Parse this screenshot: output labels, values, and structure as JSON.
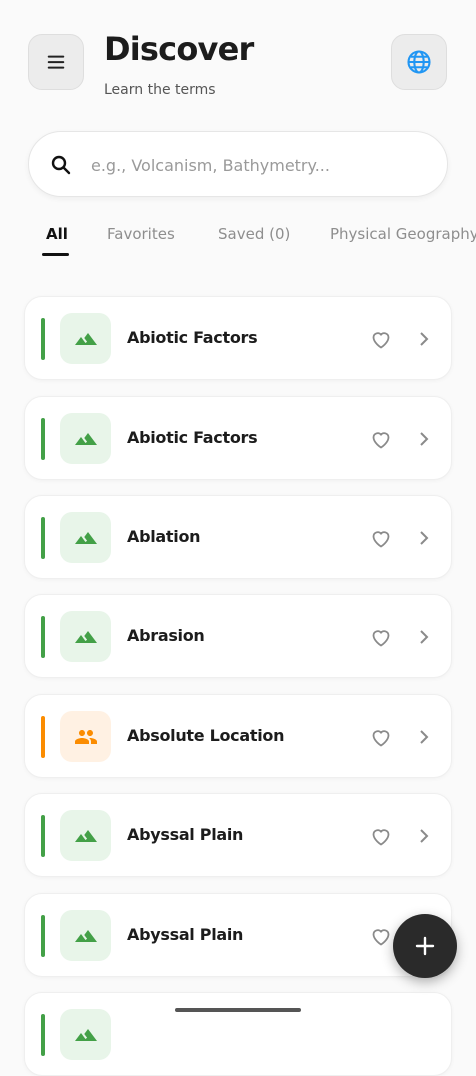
{
  "header": {
    "title": "Discover",
    "subtitle": "Learn the terms",
    "menu_icon": "hamburger-menu-icon",
    "globe_icon": "globe-icon"
  },
  "search": {
    "placeholder": "e.g., Volcanism, Bathymetry...",
    "value": "",
    "icon": "search-icon"
  },
  "tabs": [
    {
      "label": "All",
      "active": true
    },
    {
      "label": "Favorites",
      "active": false
    },
    {
      "label": "Saved (0)",
      "active": false
    },
    {
      "label": "Physical Geography",
      "active": false
    }
  ],
  "terms": [
    {
      "label": "Abiotic Factors",
      "category": "physical",
      "icon": "mountain-icon"
    },
    {
      "label": "Abiotic Factors",
      "category": "physical",
      "icon": "mountain-icon"
    },
    {
      "label": "Ablation",
      "category": "physical",
      "icon": "mountain-icon"
    },
    {
      "label": "Abrasion",
      "category": "physical",
      "icon": "mountain-icon"
    },
    {
      "label": "Absolute Location",
      "category": "human",
      "icon": "people-icon"
    },
    {
      "label": "Abyssal Plain",
      "category": "physical",
      "icon": "mountain-icon"
    },
    {
      "label": "Abyssal Plain",
      "category": "physical",
      "icon": "mountain-icon"
    },
    {
      "label": "",
      "category": "physical",
      "icon": "mountain-icon"
    }
  ],
  "colors": {
    "physical_accent": "#43a047",
    "physical_bg": "#e8f5e9",
    "human_accent": "#fb8c00",
    "human_bg": "#fff1e3",
    "globe_blue": "#2196f3"
  },
  "fab_icon": "plus-icon"
}
